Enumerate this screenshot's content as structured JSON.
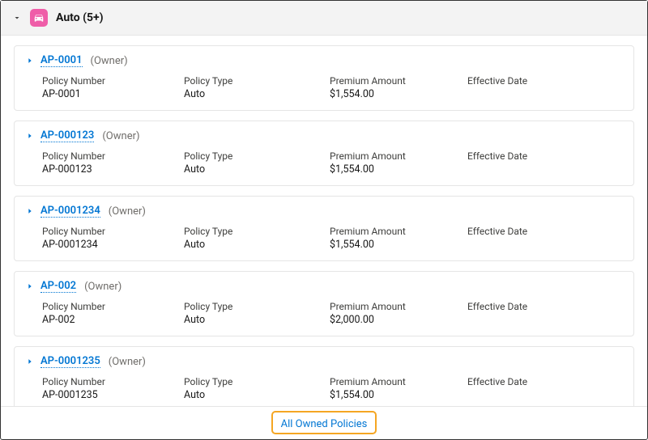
{
  "header": {
    "title": "Auto (5+)"
  },
  "labels": {
    "policyNumber": "Policy Number",
    "policyType": "Policy Type",
    "premiumAmount": "Premium Amount",
    "effectiveDate": "Effective Date",
    "owner": "(Owner)"
  },
  "policies": [
    {
      "id": "AP-0001",
      "policyNumber": "AP-0001",
      "policyType": "Auto",
      "premiumAmount": "$1,554.00",
      "effectiveDate": ""
    },
    {
      "id": "AP-000123",
      "policyNumber": "AP-000123",
      "policyType": "Auto",
      "premiumAmount": "$1,554.00",
      "effectiveDate": ""
    },
    {
      "id": "AP-0001234",
      "policyNumber": "AP-0001234",
      "policyType": "Auto",
      "premiumAmount": "$1,554.00",
      "effectiveDate": ""
    },
    {
      "id": "AP-002",
      "policyNumber": "AP-002",
      "policyType": "Auto",
      "premiumAmount": "$2,000.00",
      "effectiveDate": ""
    },
    {
      "id": "AP-0001235",
      "policyNumber": "AP-0001235",
      "policyType": "Auto",
      "premiumAmount": "$1,554.00",
      "effectiveDate": ""
    }
  ],
  "footer": {
    "allLink": "All Owned Policies"
  }
}
